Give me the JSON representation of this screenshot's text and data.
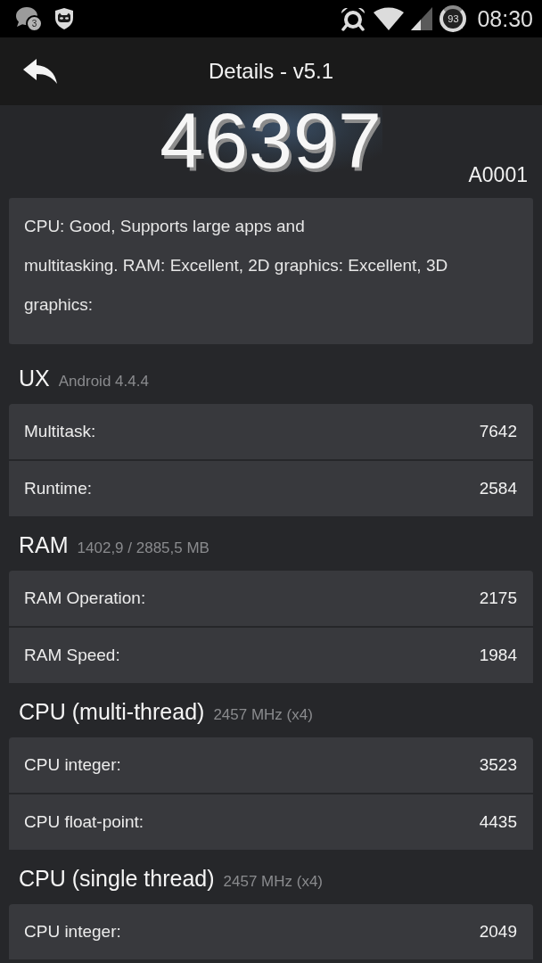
{
  "status_bar": {
    "notification_count": "3",
    "battery": "93",
    "time": "08:30"
  },
  "toolbar": {
    "title": "Details - v5.1"
  },
  "score": {
    "total": "46397",
    "device": "A0001"
  },
  "summary": "CPU: Good, Supports large apps and\nmultitasking. RAM: Excellent, 2D graphics: Excellent, 3D graphics:",
  "sections": [
    {
      "title": "UX",
      "subtitle": "Android 4.4.4",
      "rows": [
        {
          "label": "Multitask:",
          "value": "7642"
        },
        {
          "label": "Runtime:",
          "value": "2584"
        }
      ]
    },
    {
      "title": "RAM",
      "subtitle": "1402,9 / 2885,5 MB",
      "rows": [
        {
          "label": "RAM Operation:",
          "value": "2175"
        },
        {
          "label": "RAM Speed:",
          "value": "1984"
        }
      ]
    },
    {
      "title": "CPU (multi-thread)",
      "subtitle": "2457 MHz (x4)",
      "rows": [
        {
          "label": "CPU integer:",
          "value": "3523"
        },
        {
          "label": "CPU float-point:",
          "value": "4435"
        }
      ]
    },
    {
      "title": "CPU (single thread)",
      "subtitle": "2457 MHz (x4)",
      "rows": [
        {
          "label": "CPU integer:",
          "value": "2049"
        }
      ]
    }
  ]
}
